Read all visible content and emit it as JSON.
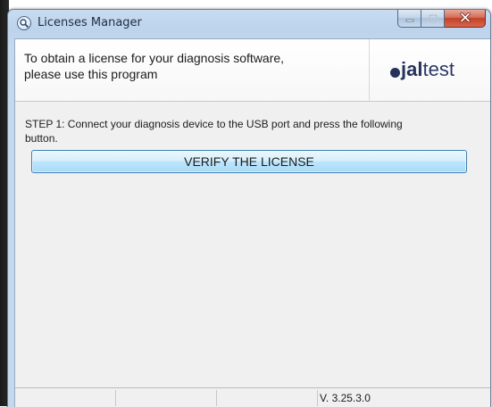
{
  "window": {
    "title": "Licenses Manager",
    "icon": "magnifier-app-icon",
    "caption_buttons": [
      "minimize-icon",
      "maximize-icon",
      "close-icon"
    ]
  },
  "header": {
    "text_line1": "To obtain a license for your diagnosis software,",
    "text_line2": "please use this program",
    "logo_bold": "jal",
    "logo_light": "test"
  },
  "main": {
    "step_line1": "STEP 1: Connect your diagnosis device to the USB port and press the following",
    "step_line2": "button.",
    "verify_button_label": "VERIFY THE LICENSE"
  },
  "statusbar": {
    "version": "V. 3.25.3.0"
  },
  "colors": {
    "logo": "#26325c",
    "button_border": "#3c7fb1",
    "close_button": "#c2412a"
  }
}
